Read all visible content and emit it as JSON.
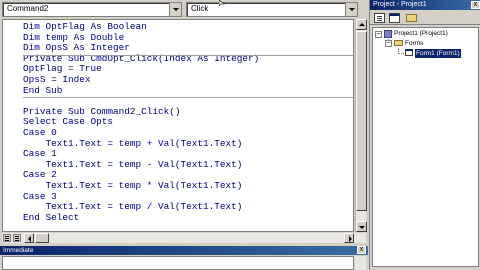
{
  "code_window": {
    "object_combo": "Command2",
    "procedure_combo": "Click",
    "sections": [
      [
        "Dim OptFlag As Boolean",
        "Dim temp As Double",
        "Dim OpsS As Integer"
      ],
      [
        "Private Sub CmdOpt_Click(Index As Integer)",
        "OptFlag = True",
        "OpsS = Index",
        "End Sub"
      ],
      [
        "",
        "Private Sub Command2_Click()",
        "Select Case Opts",
        "Case 0",
        "    Text1.Text = temp + Val(Text1.Text)",
        "Case 1",
        "    Text1.Text = temp - Val(Text1.Text)",
        "Case 2",
        "    Text1.Text = temp * Val(Text1.Text)",
        "Case 3",
        "    Text1.Text = temp / Val(Text1.Text)",
        "End Select"
      ]
    ]
  },
  "project_explorer": {
    "title": "Project - Project1",
    "close_label": "x",
    "tree": {
      "project": "Project1 (Project1)",
      "folder": "Forms",
      "form": "Form1 (Form1)"
    }
  },
  "immediate": {
    "title": "Immediate",
    "close_label": "x"
  },
  "colors": {
    "code_text": "#00008b",
    "title_bar": "#0a246a",
    "selection": "#0a246a"
  }
}
